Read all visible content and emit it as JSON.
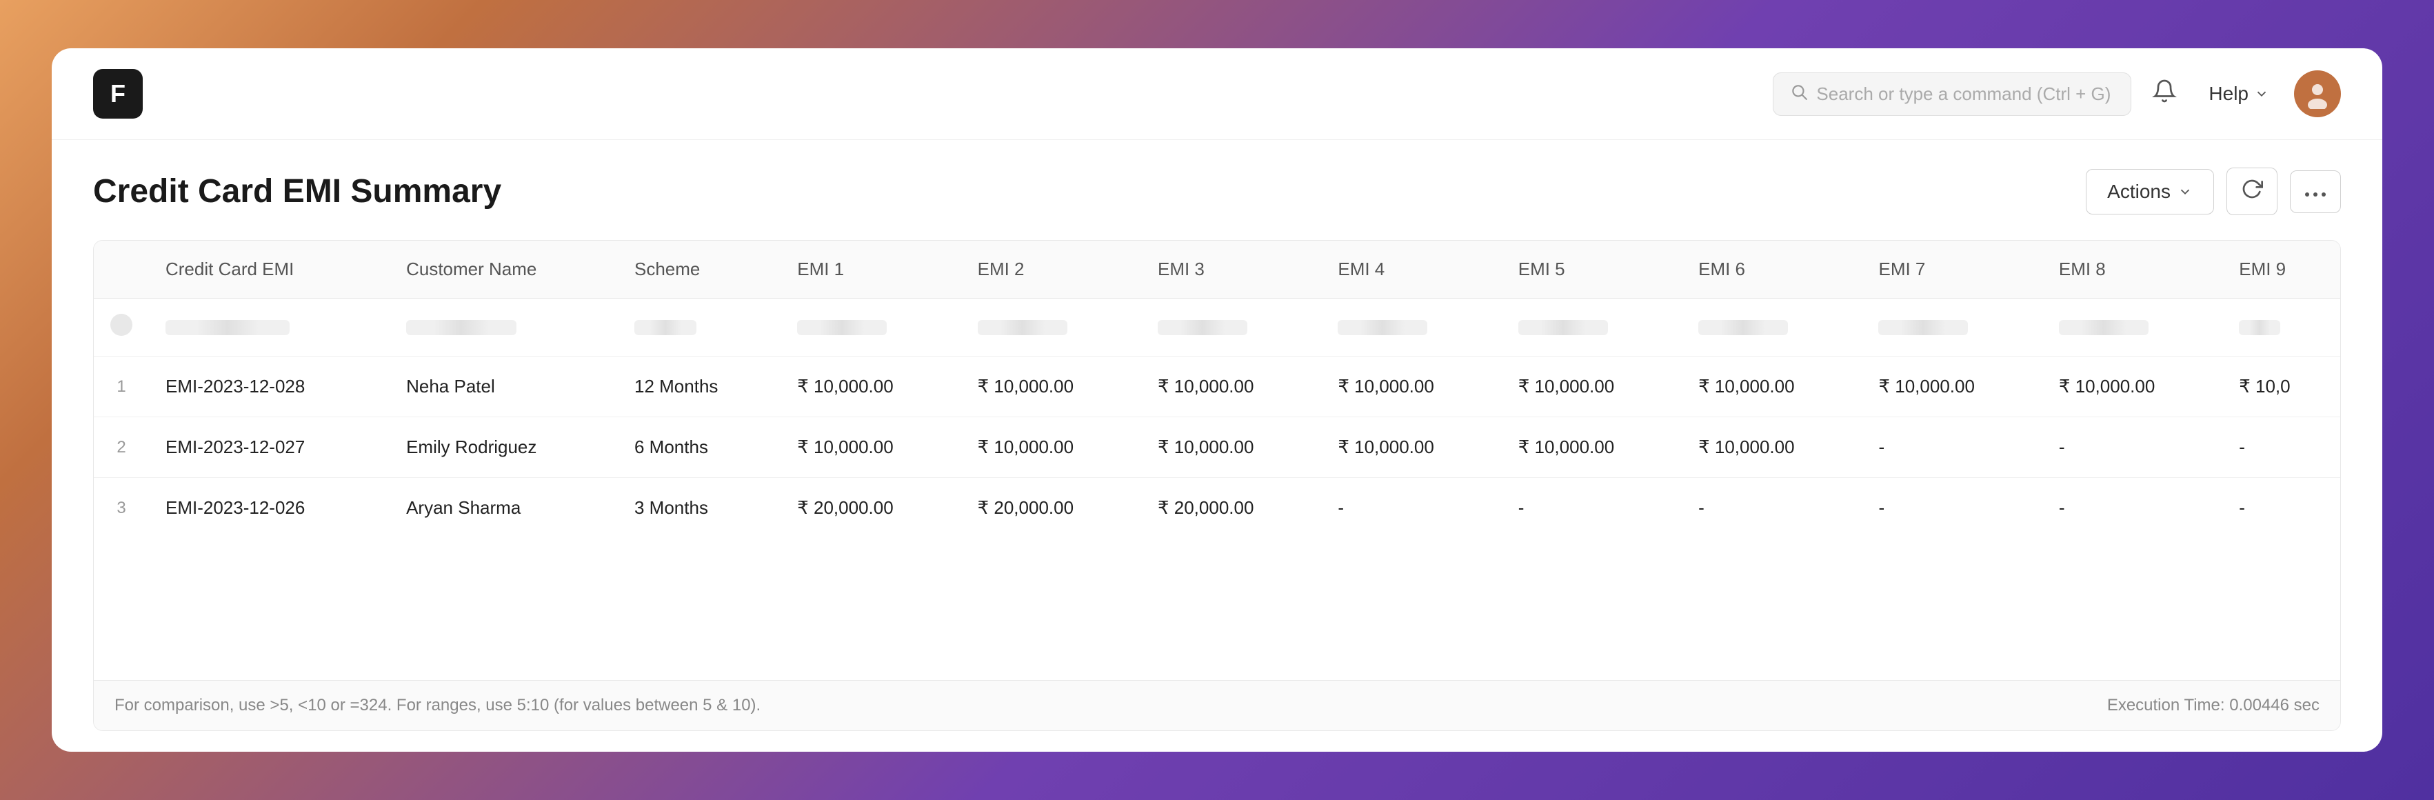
{
  "navbar": {
    "logo_label": "F",
    "search_placeholder": "Search or type a command (Ctrl + G)",
    "help_label": "Help",
    "bell_icon": "🔔"
  },
  "page": {
    "title": "Credit Card EMI Summary",
    "actions_label": "Actions",
    "refresh_icon": "↻",
    "more_icon": "···"
  },
  "table": {
    "columns": [
      {
        "key": "row_num",
        "label": ""
      },
      {
        "key": "credit_card_emi",
        "label": "Credit Card EMI"
      },
      {
        "key": "customer_name",
        "label": "Customer Name"
      },
      {
        "key": "scheme",
        "label": "Scheme"
      },
      {
        "key": "emi1",
        "label": "EMI 1"
      },
      {
        "key": "emi2",
        "label": "EMI 2"
      },
      {
        "key": "emi3",
        "label": "EMI 3"
      },
      {
        "key": "emi4",
        "label": "EMI 4"
      },
      {
        "key": "emi5",
        "label": "EMI 5"
      },
      {
        "key": "emi6",
        "label": "EMI 6"
      },
      {
        "key": "emi7",
        "label": "EMI 7"
      },
      {
        "key": "emi8",
        "label": "EMI 8"
      },
      {
        "key": "emi9",
        "label": "EMI 9"
      }
    ],
    "rows": [
      {
        "row_num": "1",
        "credit_card_emi": "EMI-2023-12-028",
        "customer_name": "Neha Patel",
        "scheme": "12 Months",
        "emi1": "₹ 10,000.00",
        "emi2": "₹ 10,000.00",
        "emi3": "₹ 10,000.00",
        "emi4": "₹ 10,000.00",
        "emi5": "₹ 10,000.00",
        "emi6": "₹ 10,000.00",
        "emi7": "₹ 10,000.00",
        "emi8": "₹ 10,000.00",
        "emi9": "₹ 10,0"
      },
      {
        "row_num": "2",
        "credit_card_emi": "EMI-2023-12-027",
        "customer_name": "Emily Rodriguez",
        "scheme": "6 Months",
        "emi1": "₹ 10,000.00",
        "emi2": "₹ 10,000.00",
        "emi3": "₹ 10,000.00",
        "emi4": "₹ 10,000.00",
        "emi5": "₹ 10,000.00",
        "emi6": "₹ 10,000.00",
        "emi7": "-",
        "emi8": "-",
        "emi9": "-"
      },
      {
        "row_num": "3",
        "credit_card_emi": "EMI-2023-12-026",
        "customer_name": "Aryan Sharma",
        "scheme": "3 Months",
        "emi1": "₹ 20,000.00",
        "emi2": "₹ 20,000.00",
        "emi3": "₹ 20,000.00",
        "emi4": "-",
        "emi5": "-",
        "emi6": "-",
        "emi7": "-",
        "emi8": "-",
        "emi9": "-"
      }
    ],
    "footer": {
      "hint": "For comparison, use >5, <10 or =324. For ranges, use 5:10 (for values between 5 & 10).",
      "execution_time": "Execution Time: 0.00446 sec"
    }
  }
}
